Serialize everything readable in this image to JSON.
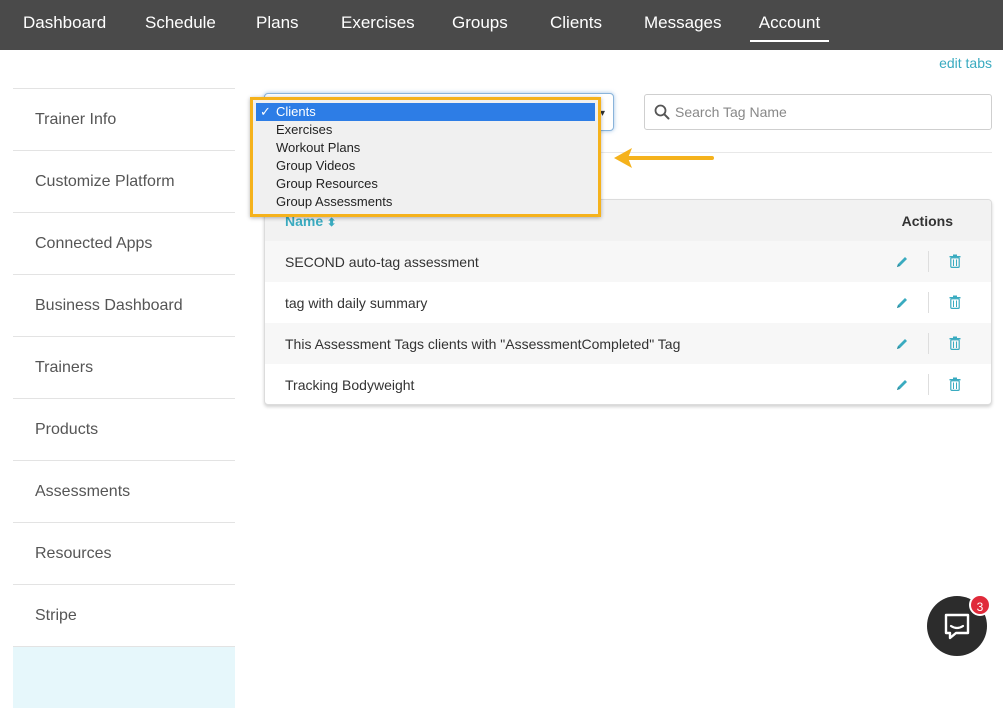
{
  "nav": {
    "tabs": [
      {
        "label": "Dashboard"
      },
      {
        "label": "Schedule"
      },
      {
        "label": "Plans"
      },
      {
        "label": "Exercises"
      },
      {
        "label": "Groups"
      },
      {
        "label": "Clients"
      },
      {
        "label": "Messages"
      },
      {
        "label": "Account"
      }
    ],
    "active": "Account",
    "edit_tabs_label": "edit tabs"
  },
  "sidebar": {
    "items": [
      {
        "label": "Trainer Info"
      },
      {
        "label": "Customize Platform"
      },
      {
        "label": "Connected Apps"
      },
      {
        "label": "Business Dashboard"
      },
      {
        "label": "Trainers"
      },
      {
        "label": "Products"
      },
      {
        "label": "Assessments"
      },
      {
        "label": "Resources"
      },
      {
        "label": "Stripe"
      }
    ]
  },
  "tag_type_select": {
    "selected": "Clients",
    "options": [
      {
        "label": "Clients"
      },
      {
        "label": "Exercises"
      },
      {
        "label": "Workout Plans"
      },
      {
        "label": "Group Videos"
      },
      {
        "label": "Group Resources"
      },
      {
        "label": "Group Assessments"
      }
    ],
    "check_mark": "✓"
  },
  "search": {
    "placeholder": "Search Tag Name",
    "value": ""
  },
  "table": {
    "columns": {
      "name": "Name",
      "actions": "Actions"
    },
    "sort_indicator": "⬍",
    "rows": [
      {
        "name": "SECOND auto-tag assessment"
      },
      {
        "name": "tag with daily summary"
      },
      {
        "name": "This Assessment Tags clients with \"AssessmentCompleted\" Tag"
      },
      {
        "name": "Tracking Bodyweight"
      }
    ]
  },
  "chat": {
    "badge_count": "3"
  },
  "colors": {
    "nav_bg": "#4a4a4a",
    "accent": "#3aabc0",
    "highlight_border": "#f5b21c",
    "selected_option": "#2d7de6",
    "badge": "#e02a3a"
  }
}
